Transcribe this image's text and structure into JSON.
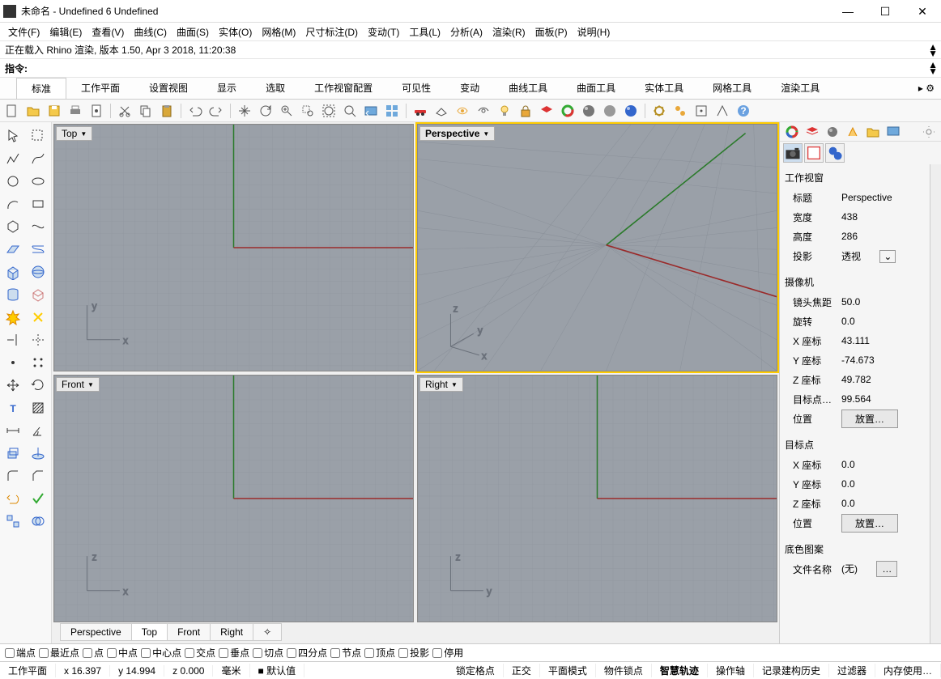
{
  "window": {
    "title": "未命名 - Undefined 6 Undefined",
    "min": "—",
    "max": "☐",
    "close": "✕"
  },
  "menu": [
    "文件(F)",
    "编辑(E)",
    "查看(V)",
    "曲线(C)",
    "曲面(S)",
    "实体(O)",
    "网格(M)",
    "尺寸标注(D)",
    "变动(T)",
    "工具(L)",
    "分析(A)",
    "渲染(R)",
    "面板(P)",
    "说明(H)"
  ],
  "history_line": "正在载入 Rhino 渲染, 版本 1.50, Apr  3 2018, 11:20:38",
  "command_label": "指令:",
  "tabs": [
    "标准",
    "工作平面",
    "设置视图",
    "显示",
    "选取",
    "工作视窗配置",
    "可见性",
    "变动",
    "曲线工具",
    "曲面工具",
    "实体工具",
    "网格工具",
    "渲染工具"
  ],
  "tabs_more": "▸ ⚙",
  "viewports": {
    "top": "Top",
    "persp": "Perspective",
    "front": "Front",
    "right": "Right"
  },
  "vptabs": [
    "Perspective",
    "Top",
    "Front",
    "Right"
  ],
  "vptab_add": "✧",
  "props": {
    "section1": "工作视窗",
    "title_k": "标题",
    "title_v": "Perspective",
    "width_k": "宽度",
    "width_v": "438",
    "height_k": "高度",
    "height_v": "286",
    "proj_k": "投影",
    "proj_v": "透视",
    "section2": "摄像机",
    "focal_k": "镜头焦距",
    "focal_v": "50.0",
    "rot_k": "旋转",
    "rot_v": "0.0",
    "x_k": "X 座标",
    "x_v": "43.111",
    "y_k": "Y 座标",
    "y_v": "-74.673",
    "z_k": "Z 座标",
    "z_v": "49.782",
    "tgt_k": "目标点…",
    "tgt_v": "99.564",
    "pos_k": "位置",
    "pos_btn": "放置…",
    "section3": "目标点",
    "tx_k": "X 座标",
    "tx_v": "0.0",
    "ty_k": "Y 座标",
    "ty_v": "0.0",
    "tz_k": "Z 座标",
    "tz_v": "0.0",
    "pos2_k": "位置",
    "pos2_btn": "放置…",
    "section4": "底色图案",
    "file_k": "文件名称",
    "file_v": "(无)",
    "file_btn": "…"
  },
  "osnap": [
    "端点",
    "最近点",
    "点",
    "中点",
    "中心点",
    "交点",
    "垂点",
    "切点",
    "四分点",
    "节点",
    "顶点",
    "投影",
    "停用"
  ],
  "status": {
    "cplane": "工作平面",
    "x": "x 16.397",
    "y": "y 14.994",
    "z": "z 0.000",
    "unit": "毫米",
    "layer_marker": "■",
    "layer": "默认值",
    "right": [
      "锁定格点",
      "正交",
      "平面模式",
      "物件锁点",
      "智慧轨迹",
      "操作轴",
      "记录建构历史",
      "过滤器",
      "内存使用…"
    ]
  }
}
